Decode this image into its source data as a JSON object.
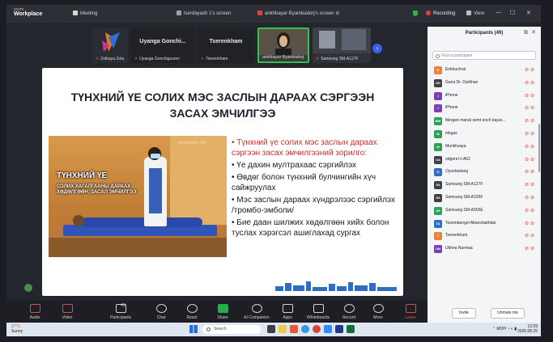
{
  "app": {
    "brand_small": "zoom",
    "brand": "Workplace"
  },
  "topbar": {
    "meeting_tab": "Meeting",
    "screen_label": "tserdayash 1's screen",
    "share_label": "ankhbayar Byambadorj's screen",
    "shield_icon": "shield-icon",
    "recording": "Recording",
    "view": "View"
  },
  "strip": {
    "tiles": [
      {
        "name": "Zolbaya Zola",
        "big": ""
      },
      {
        "name": "Uyanga Gonchigsuren",
        "big": "Uyanga Gonchi..."
      },
      {
        "name": "Tserenkham",
        "big": "Tserenkham"
      },
      {
        "name": "ankhbayar Byambadorj",
        "big": ""
      },
      {
        "name": "Samsung SM-A127F",
        "big": ""
      }
    ],
    "next_label": "›"
  },
  "slide": {
    "title_line1": "ТҮНХНИЙ ҮЕ СОЛИХ МЭС ЗАСЛЫН ДАРААХ СЭРГЭЭН",
    "title_line2": "ЗАСАХ ЭМЧИЛГЭЭ",
    "image_caption": "ТҮНХНИЙ ҮЕ",
    "image_subcaption": "СОЛИХ ХАГАЛГААНЫ ДАРААХ ХӨДӨЛГӨӨН, ЗАСАЛ ЭМЧИЛГЭЭ",
    "image_watermark": "www.joint.mn",
    "bullets": [
      {
        "text": "• Түнхний үе солих мэс заслын дараах сэргээн засах эмчилгээний зорилго:",
        "red": true
      },
      {
        "text": "• Үе дахин мултрахаас сэргийлэх",
        "red": false
      },
      {
        "text": "• Өвдөг болон түнхний булчингийн хүч сайжруулах",
        "red": false
      },
      {
        "text": "•  Мэс заслын дараах хүндрэлээс сэргийлэх /тромбо-эмболи/",
        "red": false
      },
      {
        "text": "• Бие даан шилжих хөдөлгөөн хийх болон туслах хэрэгсэл ашиглахад сургах",
        "red": false
      }
    ]
  },
  "toolbar": {
    "items": [
      {
        "label": "Audio",
        "icon": "microphone-icon"
      },
      {
        "label": "Video",
        "icon": "camera-icon"
      },
      {
        "label": "Participants",
        "icon": "people-icon",
        "count": "49"
      },
      {
        "label": "Chat",
        "icon": "chat-icon"
      },
      {
        "label": "React",
        "icon": "heart-icon"
      },
      {
        "label": "Share",
        "icon": "share-icon"
      },
      {
        "label": "AI Companion",
        "icon": "sparkle-icon"
      },
      {
        "label": "Apps",
        "icon": "apps-icon"
      },
      {
        "label": "Whiteboards",
        "icon": "whiteboard-icon"
      },
      {
        "label": "Record",
        "icon": "record-icon"
      },
      {
        "label": "More",
        "icon": "more-icon"
      },
      {
        "label": "Leave",
        "icon": "leave-icon"
      }
    ]
  },
  "participants": {
    "title": "Participants (49)",
    "search_placeholder": "Find a participant",
    "invite": "Invite",
    "unmute_me": "Unmute me",
    "list": [
      {
        "initials": "E",
        "color": "#e8833a",
        "name": "Enkhuchral"
      },
      {
        "initials": "GD",
        "color": "#3c3f45",
        "name": "Gana Dr. Darkhan"
      },
      {
        "initials": "I",
        "color": "#7b3fb5",
        "name": "iPhone"
      },
      {
        "initials": "I",
        "color": "#7b3fb5",
        "name": "iPhone"
      },
      {
        "initials": "MM",
        "color": "#2f9e57",
        "name": "Mergen manal semt ench bayar..."
      },
      {
        "initials": "M",
        "color": "#2f9e57",
        "name": "mkgas"
      },
      {
        "initials": "M",
        "color": "#2f9e57",
        "name": "Munkhzaya"
      },
      {
        "initials": "OA",
        "color": "#3c3f45",
        "name": "odgerel n A52"
      },
      {
        "initials": "O",
        "color": "#2f6fc2",
        "name": "Oyuntsetseg"
      },
      {
        "initials": "SS",
        "color": "#3c3f45",
        "name": "Samsung SM-A127F"
      },
      {
        "initials": "SS",
        "color": "#3c3f45",
        "name": "Samsung SM-A235F"
      },
      {
        "initials": "SS",
        "color": "#2f9e57",
        "name": "Samsung SM-A556E"
      },
      {
        "initials": "TA",
        "color": "#2f6fc2",
        "name": "Tosombengel Altanshakhdai"
      },
      {
        "initials": "T",
        "color": "#e8833a",
        "name": "Tserenkham"
      },
      {
        "initials": "UN",
        "color": "#7b3fb5",
        "name": "Ukhna Nurmaa"
      }
    ]
  },
  "taskbar": {
    "temperature": "27°C",
    "weather": "Sunny",
    "search": "Search",
    "lang": "МОН",
    "time": "12:29",
    "date": "2025.08.25"
  }
}
